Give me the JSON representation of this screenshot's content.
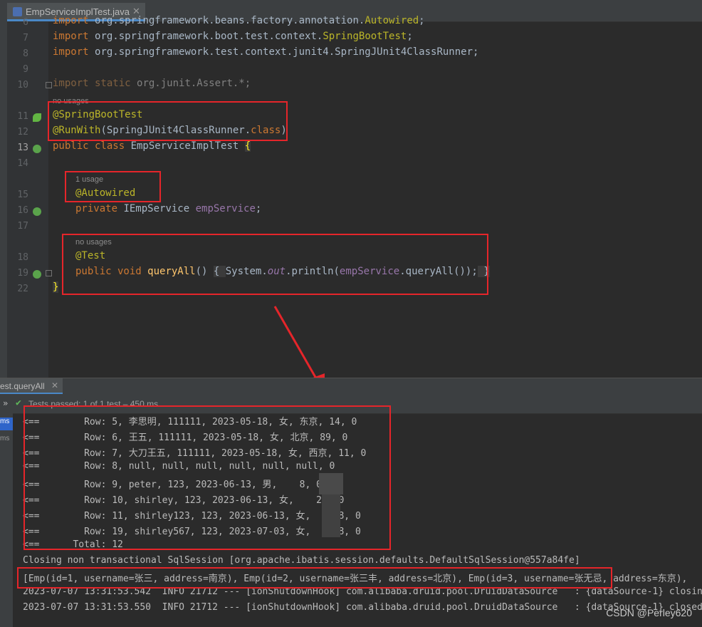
{
  "editor": {
    "tab_title": "EmpServiceImplTest.java",
    "lines": [
      {
        "no": "6",
        "text": "import org.springframework.beans.factory.annotation.Autowired;"
      },
      {
        "no": "7",
        "text": "import org.springframework.boot.test.context.SpringBootTest;"
      },
      {
        "no": "8",
        "text": "import org.springframework.test.context.junit4.SpringJUnit4ClassRunner;"
      },
      {
        "no": "9",
        "text": ""
      },
      {
        "no": "10",
        "text": "import static org.junit.Assert.*;"
      },
      {
        "no": "11",
        "text": "@SpringBootTest"
      },
      {
        "no": "12",
        "text": "@RunWith(SpringJUnit4ClassRunner.class)"
      },
      {
        "no": "13",
        "text": "public class EmpServiceImplTest {"
      },
      {
        "no": "14",
        "text": ""
      },
      {
        "no": "15",
        "text": "@Autowired"
      },
      {
        "no": "16",
        "text": "private IEmpService empService;"
      },
      {
        "no": "17",
        "text": ""
      },
      {
        "no": "18",
        "text": "@Test"
      },
      {
        "no": "19",
        "text": "public void queryAll() { System.out.println(empService.queryAll()); }"
      },
      {
        "no": "22",
        "text": "}"
      }
    ],
    "hints": {
      "no_usages_1": "no usages",
      "one_usage": "1 usage",
      "no_usages_2": "no usages"
    }
  },
  "run_panel": {
    "tab_label": "est.queryAll",
    "status": "Tests passed: 1 of 1 test – 450 ms",
    "side_labels": [
      "ms",
      "ms"
    ],
    "console": [
      "<==        Row: 5, 李思明, 111111, 2023-05-18, 女, 东京, 14, 0",
      "<==        Row: 6, 王五, 111111, 2023-05-18, 女, 北京, 89, 0",
      "<==        Row: 7, 大刀王五, 111111, 2023-05-18, 女, 西京, 11, 0",
      "<==        Row: 8, null, null, null, null, null, null, 0",
      "<==        Row: 9, peter, 123, 2023-06-13, 男,    8, 0",
      "<==        Row: 10, shirley, 123, 2023-06-13, 女,    28, 0",
      "<==        Row: 11, shirley123, 123, 2023-06-13, 女,    28, 0",
      "<==        Row: 19, shirley567, 123, 2023-07-03, 女,    28, 0",
      "<==      Total: 12",
      "Closing non transactional SqlSession [org.apache.ibatis.session.defaults.DefaultSqlSession@557a84fe]",
      "[Emp(id=1, username=张三, address=南京), Emp(id=2, username=张三丰, address=北京), Emp(id=3, username=张无忌, address=东京),",
      "2023-07-07 13:31:53.542  INFO 21712 --- [ionShutdownHook] com.alibaba.druid.pool.DruidDataSource   : {dataSource-1} closing",
      "2023-07-07 13:31:53.550  INFO 21712 --- [ionShutdownHook] com.alibaba.druid.pool.DruidDataSource   : {dataSource-1} closed"
    ]
  },
  "watermark": "CSDN @Perley620",
  "colors": {
    "highlight_box": "#e5252a",
    "annotation": "#bbb529",
    "keyword": "#cc7832",
    "field": "#9876aa",
    "method": "#ffc66d"
  }
}
